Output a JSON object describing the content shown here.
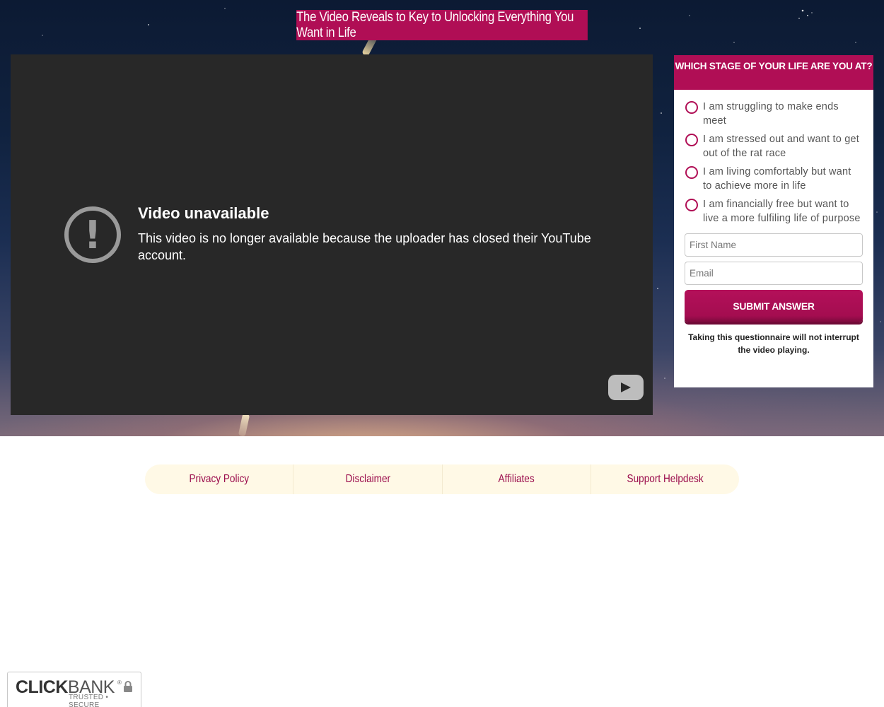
{
  "hero": {
    "headline": "The Video Reveals to Key to Unlocking Everything You Want in Life"
  },
  "video": {
    "error_title": "Video unavailable",
    "error_message": "This video is no longer available because the uploader has closed their YouTube account.",
    "icons": {
      "error": "exclamation-circle-icon",
      "logo": "youtube-logo-icon"
    }
  },
  "quiz": {
    "heading": "WHICH STAGE OF YOUR LIFE ARE YOU AT?",
    "options": [
      {
        "label": "I am struggling to make ends meet"
      },
      {
        "label": "I am stressed out and want to get out of the rat race"
      },
      {
        "label": "I am living comfortably but want to achieve more in life"
      },
      {
        "label": "I am financially free but want to live a more fulfiling life of purpose"
      }
    ],
    "first_name_placeholder": "First Name",
    "email_placeholder": "Email",
    "submit_label": "SUBMIT ANSWER",
    "note": "Taking this questionnaire will not interrupt the video playing."
  },
  "footer": {
    "links": [
      {
        "label": "Privacy Policy"
      },
      {
        "label": "Disclaimer"
      },
      {
        "label": "Affiliates"
      },
      {
        "label": "Support Helpdesk"
      }
    ]
  },
  "badge": {
    "brand_bold": "CLICK",
    "brand_light": "BANK",
    "registered": "®",
    "tagline": "TRUSTED • SECURE",
    "icon": "lock-icon"
  },
  "colors": {
    "accent": "#b00e55",
    "link": "#9b0c4c",
    "footer_bg": "#fff9e6",
    "video_bg": "#282828"
  }
}
